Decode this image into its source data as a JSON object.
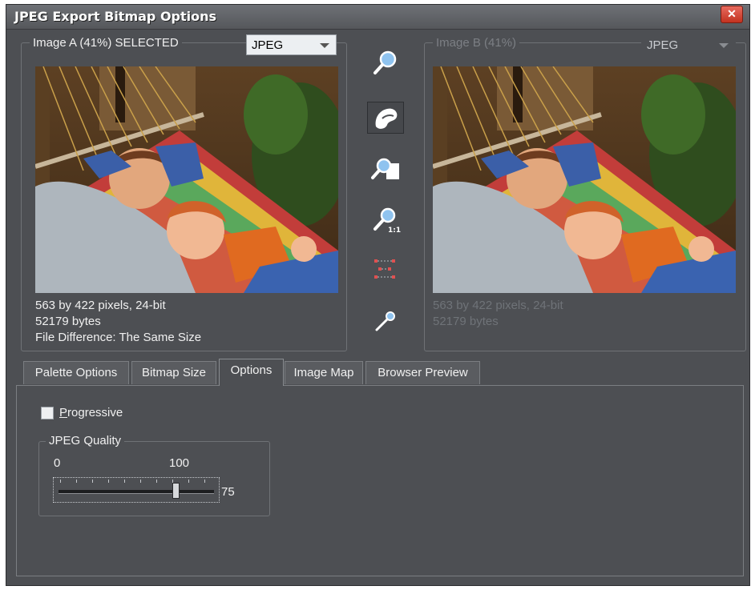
{
  "window": {
    "title": "JPEG Export Bitmap Options",
    "close_label": "✕"
  },
  "image_a": {
    "label": "Image A (41%) SELECTED",
    "format": "JPEG",
    "info_dimensions": "563 by 422 pixels, 24-bit",
    "info_bytes": "52179 bytes",
    "info_difference": "File Difference: The Same Size"
  },
  "image_b": {
    "label": "Image B (41%)",
    "format": "JPEG",
    "info_dimensions": "563 by 422 pixels, 24-bit",
    "info_bytes": "52179 bytes"
  },
  "toolbar": {
    "tools": [
      "zoom-icon",
      "pan-hand-icon",
      "zoom-to-page-icon",
      "zoom-actual-size-icon",
      "grid-snap-icon",
      "color-picker-icon"
    ],
    "active_tool": "pan-hand-icon"
  },
  "tabs": [
    {
      "label": "Palette Options",
      "active": false
    },
    {
      "label": "Bitmap Size",
      "active": false
    },
    {
      "label": "Options",
      "active": true
    },
    {
      "label": "Image Map",
      "active": false
    },
    {
      "label": "Browser Preview",
      "active": false
    }
  ],
  "options": {
    "progressive_mnemonic": "P",
    "progressive_rest": "rogressive",
    "progressive_checked": false,
    "quality_group": "JPEG Quality",
    "scale_min": "0",
    "scale_max": "100",
    "quality_value": "75",
    "quality_fraction": 0.75
  },
  "colors": {
    "window_bg": "#4d4f53",
    "close_red": "#d2432f"
  }
}
